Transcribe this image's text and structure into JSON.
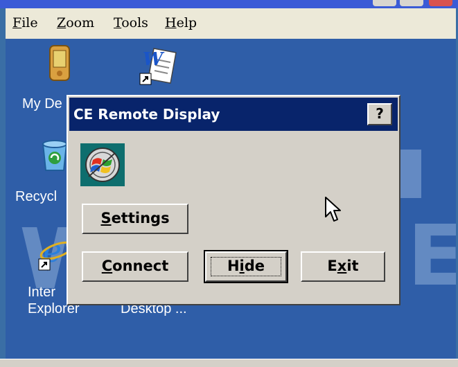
{
  "menu": {
    "items": [
      {
        "first": "F",
        "rest": "ile"
      },
      {
        "first": "Z",
        "rest": "oom"
      },
      {
        "first": "T",
        "rest": "ools"
      },
      {
        "first": "H",
        "rest": "elp"
      }
    ]
  },
  "desktop": {
    "icons": [
      {
        "name": "my-device",
        "label_line1": "My De"
      },
      {
        "name": "word-shortcut",
        "label_line1": ""
      },
      {
        "name": "recycle-bin",
        "label_line1": "Recycl"
      },
      {
        "name": "internet-explorer",
        "label_line1": "Inter",
        "label_line2": "Explorer"
      },
      {
        "name": "desktop-shortcut",
        "label_line1": "Desktop ..."
      }
    ]
  },
  "dialog": {
    "title": "CE Remote Display",
    "help_label": "?",
    "buttons": {
      "settings": {
        "before": "",
        "u": "S",
        "after": "ettings"
      },
      "connect": {
        "before": "",
        "u": "C",
        "after": "onnect"
      },
      "hide": {
        "before": "H",
        "u": "i",
        "after": "de"
      },
      "exit": {
        "before": "E",
        "u": "x",
        "after": "it"
      }
    }
  },
  "colors": {
    "desktop_bg": "#2f5ea8",
    "title_bar": "#08246b",
    "dialog_face": "#d4d0c8"
  }
}
